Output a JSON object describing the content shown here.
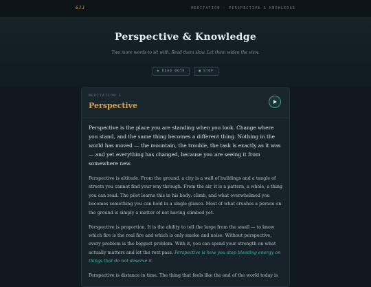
{
  "header": {
    "logo": "6JJ",
    "breadcrumb": "Meditation · Perspective & Knowledge"
  },
  "hero": {
    "title": "Perspective & Knowledge",
    "subtitle": "Two more words to sit with. Read them slow. Let them widen the view."
  },
  "controls": {
    "read_both_label": "Read both",
    "read_both_icon": "play-icon",
    "stop_label": "Stop",
    "stop_icon": "stop-icon"
  },
  "card": {
    "kicker": "Meditation I",
    "title": "Perspective",
    "play_icon": "play-icon",
    "paragraphs": {
      "p1": "Perspective is the place you are standing when you look. Change where you stand, and the same thing becomes a different thing. Nothing in the world has moved — the mountain, the trouble, the task is exactly as it was — and yet everything has changed, because you are seeing it from somewhere new.",
      "p2": "Perspective is altitude. From the ground, a city is a wall of buildings and a tangle of streets you cannot find your way through. From the air, it is a pattern, a whole, a thing you can read. The pilot learns this in his body: climb, and what overwhelmed you becomes something you can hold in a single glance. Most of what crushes a person on the ground is simply a matter of not having climbed yet.",
      "p3": "Perspective is proportion. It is the ability to tell the large from the small — to know which fire is the real fire and which is only smoke and noise. Without perspective, every problem is the biggest problem. With it, you can spend your strength on what actually matters and let the rest pass.",
      "p3_highlight": "Perspective is how you stop bleeding energy on things that do not deserve it.",
      "p4": "Perspective is distance in time. The thing that feels like the end of the world today is"
    }
  },
  "colors": {
    "accent": "#4bbfad",
    "title_gold": "#e0a244",
    "background": "#10191d"
  }
}
